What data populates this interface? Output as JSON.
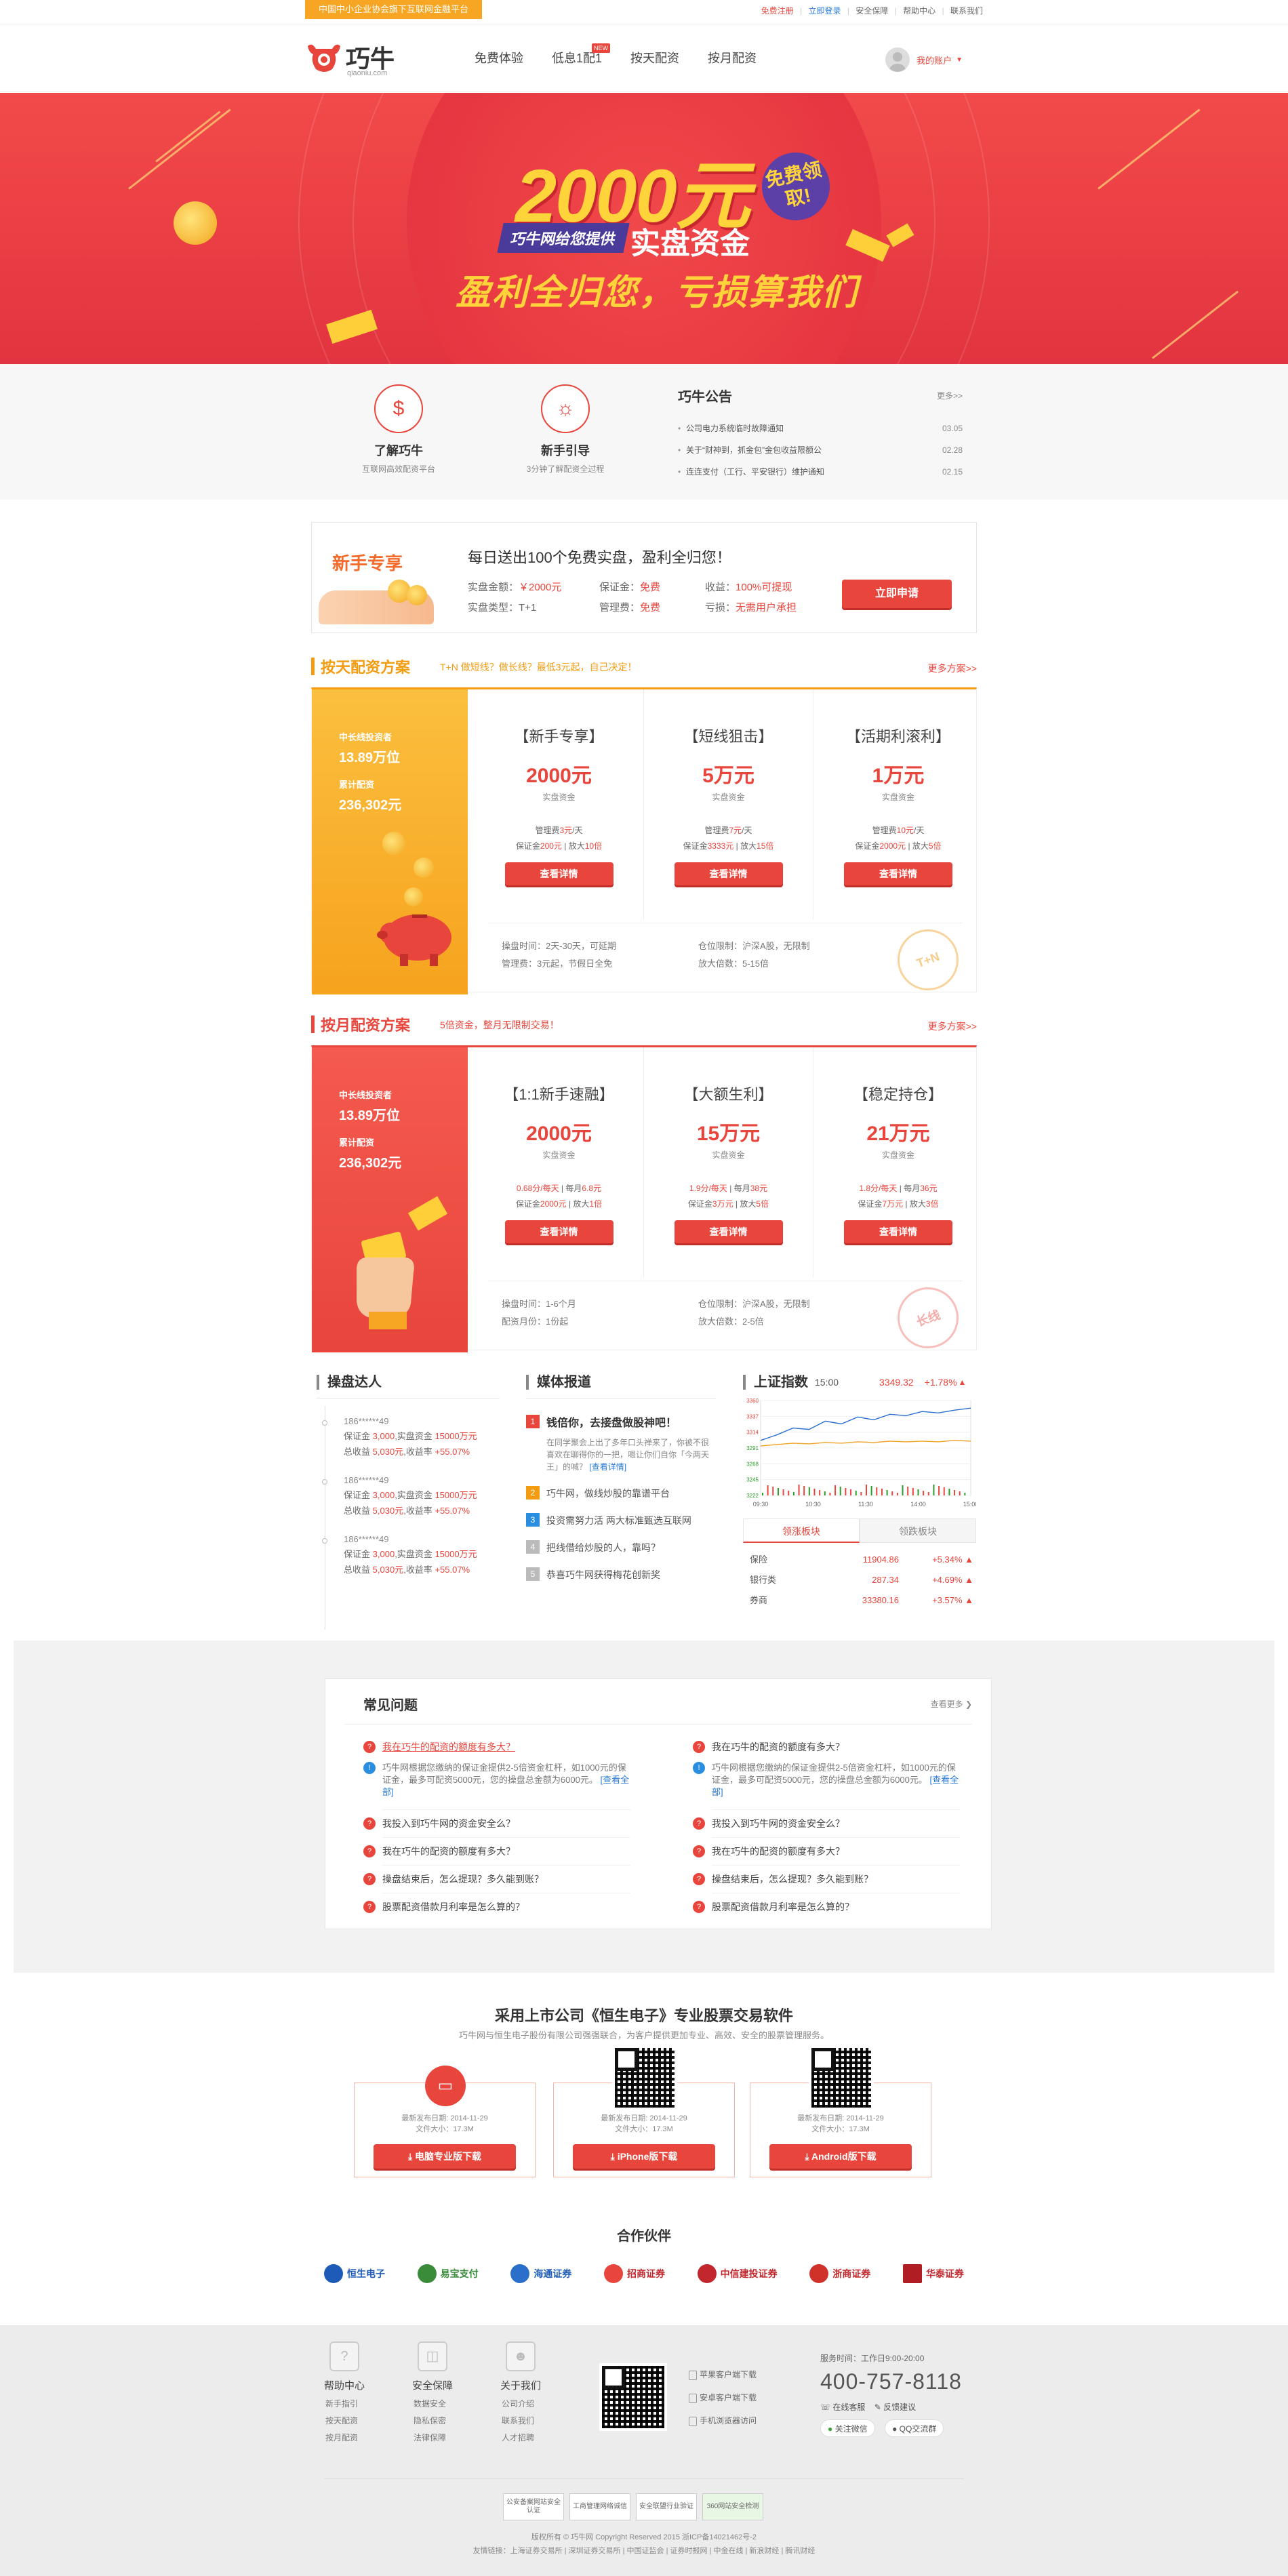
{
  "topbar": {
    "slogan": "中国中小企业协会旗下互联网金融平台",
    "links": {
      "register": "免费注册",
      "login": "立即登录",
      "safety": "安全保障",
      "help": "帮助中心",
      "contact": "联系我们"
    }
  },
  "header": {
    "logo_text": "巧牛",
    "logo_sub": "qiaoniu.com",
    "nav": [
      "免费体验",
      "低息1配1",
      "按天配资",
      "按月配资"
    ],
    "new_badge": "NEW",
    "account": "我的账户"
  },
  "banner": {
    "amount": "2000元",
    "free": "免费领取!",
    "tag": "巧牛网给您提供",
    "real": "实盘资金",
    "slogan": "盈利全归您，亏损算我们"
  },
  "features": [
    {
      "title": "了解巧牛",
      "sub": "互联网高效配资平台"
    },
    {
      "title": "新手引导",
      "sub": "3分钟了解配资全过程"
    }
  ],
  "notice": {
    "title": "巧牛公告",
    "more": "更多>>",
    "items": [
      {
        "text": "公司电力系统临时故障通知",
        "date": "03.05"
      },
      {
        "text": "关于“财神到，抓金包”金包收益限额公",
        "date": "02.28"
      },
      {
        "text": "连连支付（工行、平安银行）维护通知",
        "date": "02.15"
      }
    ]
  },
  "newbie": {
    "label": "新手专享",
    "headline": "每日送出100个免费实盘，盈利全归您！",
    "amount_k": "实盘金额：",
    "amount_v": "￥2000元",
    "deposit_k": "保证金：",
    "deposit_v": "免费",
    "profit_k": "收益：",
    "profit_v": "100%可提现",
    "type_k": "实盘类型：",
    "type_v": "T+1",
    "fee_k": "管理费：",
    "fee_v": "免费",
    "loss_k": "亏损：",
    "loss_v": "无需用户承担",
    "button": "立即申请"
  },
  "day_plan": {
    "title": "按天配资方案",
    "sub": "T+N 做短线？做长线？最低3元起，自己决定！",
    "more": "更多方案>>",
    "left": {
      "l1": "中长线投资者",
      "v1": "13.89万位",
      "l2": "累计配资",
      "v2": "236,302元"
    },
    "cards": [
      {
        "name": "【新手专享】",
        "amount": "2000元",
        "cap": "实盘资金",
        "f1a": "管理费",
        "f1b": "3元",
        "f1c": "/天",
        "f2a": "保证金",
        "f2b": "200元",
        "f2c": "放大",
        "f2d": "10倍",
        "btn": "查看详情"
      },
      {
        "name": "【短线狙击】",
        "amount": "5万元",
        "cap": "实盘资金",
        "f1a": "管理费",
        "f1b": "7元",
        "f1c": "/天",
        "f2a": "保证金",
        "f2b": "3333元",
        "f2c": "放大",
        "f2d": "15倍",
        "btn": "查看详情"
      },
      {
        "name": "【活期利滚利】",
        "amount": "1万元",
        "cap": "实盘资金",
        "f1a": "管理费",
        "f1b": "10元",
        "f1c": "/天",
        "f2a": "保证金",
        "f2b": "2000元",
        "f2c": "放大",
        "f2d": "5倍",
        "btn": "查看详情"
      }
    ],
    "foot": {
      "a": "操盘时间：2天-30天，可延期",
      "b": "管理费：3元起，节假日全免",
      "c": "仓位限制：沪深A股，无限制",
      "d": "放大倍数：5-15倍"
    },
    "stamp": "T+N"
  },
  "month_plan": {
    "title": "按月配资方案",
    "sub": "5倍资金，整月无限制交易！",
    "more": "更多方案>>",
    "left": {
      "l1": "中长线投资者",
      "v1": "13.89万位",
      "l2": "累计配资",
      "v2": "236,302元"
    },
    "cards": [
      {
        "name": "【1:1新手速融】",
        "amount": "2000元",
        "cap": "实盘资金",
        "f1a": "0.68分/每天",
        "f1b": "每月",
        "f1c": "6.8元",
        "f2a": "保证金",
        "f2b": "2000元",
        "f2c": "放大",
        "f2d": "1倍",
        "btn": "查看详情"
      },
      {
        "name": "【大额生利】",
        "amount": "15万元",
        "cap": "实盘资金",
        "f1a": "1.9分/每天",
        "f1b": "每月",
        "f1c": "38元",
        "f2a": "保证金",
        "f2b": "3万元",
        "f2c": "放大",
        "f2d": "5倍",
        "btn": "查看详情"
      },
      {
        "name": "【稳定持仓】",
        "amount": "21万元",
        "cap": "实盘资金",
        "f1a": "1.8分/每天",
        "f1b": "每月",
        "f1c": "36元",
        "f2a": "保证金",
        "f2b": "7万元",
        "f2c": "放大",
        "f2d": "3倍",
        "btn": "查看详情"
      }
    ],
    "foot": {
      "a": "操盘时间：1-6个月",
      "b": "配资月份：1份起",
      "c": "仓位限制：沪深A股，无限制",
      "d": "放大倍数：2-5倍"
    },
    "stamp": "长线"
  },
  "experts": {
    "title": "操盘达人",
    "items": [
      {
        "user": "186******49",
        "l1a": "保证金",
        "l1b": "3,000",
        "l1c": ",实盘资金",
        "l1d": "15000万元",
        "l2a": "总收益",
        "l2b": "5,030元",
        "l2c": ",收益率",
        "l2d": "+55.07%"
      },
      {
        "user": "186******49",
        "l1a": "保证金",
        "l1b": "3,000",
        "l1c": ",实盘资金",
        "l1d": "15000万元",
        "l2a": "总收益",
        "l2b": "5,030元",
        "l2c": ",收益率",
        "l2d": "+55.07%"
      },
      {
        "user": "186******49",
        "l1a": "保证金",
        "l1b": "3,000",
        "l1c": ",实盘资金",
        "l1d": "15000万元",
        "l2a": "总收益",
        "l2b": "5,030元",
        "l2c": ",收益率",
        "l2d": "+55.07%"
      }
    ]
  },
  "media": {
    "title": "媒体报道",
    "top": {
      "n": "1",
      "title": "钱倍你，去接盘做股神吧！",
      "desc": "在同学聚会上出了多年口头禅来了，你被不很喜欢在聊得你的一把，嗯让你们自你「今两天王」的喊？",
      "link": "[查看详情]"
    },
    "items": [
      {
        "n": "2",
        "text": "巧牛网，做线炒股的靠谱平台"
      },
      {
        "n": "3",
        "text": "投资需努力活 两大标准甄选互联网"
      },
      {
        "n": "4",
        "text": "把线借给炒股的人，靠吗？"
      },
      {
        "n": "5",
        "text": "恭喜巧牛网获得梅花创新奖"
      }
    ]
  },
  "index": {
    "title": "上证指数",
    "time": "15:00",
    "value": "3349.32",
    "change": "+1.78%",
    "y_ticks": [
      "3360",
      "3337",
      "3314",
      "3291",
      "3268",
      "3245",
      "3222"
    ],
    "x_ticks": [
      "09:30",
      "10:30",
      "11:30",
      "14:00",
      "15:00"
    ],
    "tab_on": "领涨板块",
    "tab_off": "领跌板块",
    "rows": [
      {
        "name": "保险",
        "val": "11904.86",
        "chg": "+5.34%"
      },
      {
        "name": "银行类",
        "val": "287.34",
        "chg": "+4.69%"
      },
      {
        "name": "券商",
        "val": "33380.16",
        "chg": "+3.57%"
      }
    ]
  },
  "chart_data": {
    "type": "line",
    "title": "上证指数",
    "x": [
      "09:30",
      "10:30",
      "11:30",
      "14:00",
      "15:00"
    ],
    "ylim": [
      3222,
      3360
    ],
    "series": [
      {
        "values": [
          3302,
          3310,
          3320,
          3318,
          3330,
          3326,
          3336,
          3332,
          3340,
          3338,
          3344,
          3342,
          3346,
          3349
        ]
      },
      {
        "values": [
          3294,
          3296,
          3298,
          3297,
          3299,
          3298,
          3300,
          3299,
          3301,
          3300,
          3301,
          3300,
          3302,
          3301
        ]
      }
    ]
  },
  "faq": {
    "title": "常见问题",
    "more": "查看更多",
    "left": {
      "q1": "我在巧牛的配资的额度有多大？",
      "a1": "巧牛网根据您缴纳的保证金提供2-5倍资金杠杆，如1000元的保证金，最多可配资5000元，您的操盘总金额为6000元。",
      "a1_link": "[查看全部]",
      "qs": [
        "我投入到巧牛网的资金安全么？",
        "我在巧牛的配资的额度有多大？",
        "操盘结束后，怎么提现？多久能到账？",
        "股票配资借款月利率是怎么算的？"
      ]
    },
    "right": {
      "q1": "我在巧牛的配资的额度有多大？",
      "a1": "巧牛网根据您缴纳的保证金提供2-5倍资金杠杆，如1000元的保证金，最多可配资5000元，您的操盘总金额为6000元。",
      "a1_link": "[查看全部]",
      "qs": [
        "我投入到巧牛网的资金安全么？",
        "我在巧牛的配资的额度有多大？",
        "操盘结束后，怎么提现？多久能到账？",
        "股票配资借款月利率是怎么算的？"
      ]
    }
  },
  "software": {
    "title": "采用上市公司《恒生电子》专业股票交易软件",
    "sub": "巧牛网与恒生电子股份有限公司强强联合，为客户提供更加专业、高效、安全的股票管理服务。",
    "items": [
      {
        "meta1": "最新发布日期: 2014-11-29",
        "meta2": "文件大小：17.3M",
        "btn": "电脑专业版下载"
      },
      {
        "meta1": "最新发布日期: 2014-11-29",
        "meta2": "文件大小：17.3M",
        "btn": "iPhone版下载"
      },
      {
        "meta1": "最新发布日期: 2014-11-29",
        "meta2": "文件大小：17.3M",
        "btn": "Android版下载"
      }
    ]
  },
  "partners": {
    "title": "合作伙伴",
    "items": [
      "恒生电子",
      "易宝支付",
      "海通证券",
      "招商证券",
      "中信建投证券",
      "浙商证券",
      "华泰证券"
    ]
  },
  "footer": {
    "cols": [
      {
        "title": "帮助中心",
        "links": [
          "新手指引",
          "按天配资",
          "按月配资"
        ]
      },
      {
        "title": "安全保障",
        "links": [
          "数据安全",
          "隐私保密",
          "法律保障"
        ]
      },
      {
        "title": "关于我们",
        "links": [
          "公司介绍",
          "联系我们",
          "人才招聘"
        ]
      }
    ],
    "apps": [
      "苹果客户端下载",
      "安卓客户端下载",
      "手机浏览器访问"
    ],
    "hours": "服务时间：工作日9:00-20:00",
    "tel": "400-757-8118",
    "online": "在线客服",
    "feedback": "反馈建议",
    "wechat": "关注微信",
    "qq": "QQ交流群",
    "badges": [
      "公安备案网站安全认证",
      "工商管理网络诚信",
      "安全联盟行业验证",
      "360网站安全检测"
    ],
    "copyright": "版权所有 © 巧牛网  Copyright Reserved 2015  浙ICP备14021462号-2",
    "links": "友情链接：上海证券交易所  |  深圳证券交易所  |  中国证监会  |  证券时报网  |  中金在线  |  新浪财经  |  腾讯财经"
  }
}
